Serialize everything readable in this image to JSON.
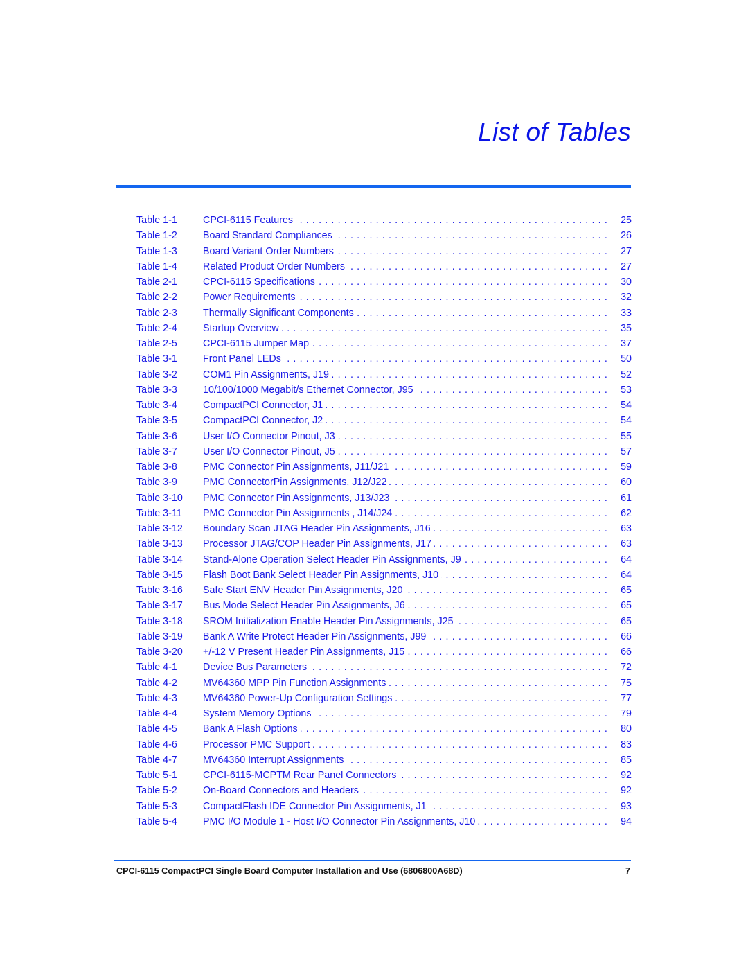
{
  "page": {
    "title": "List of Tables",
    "accent_color": "#1366f0",
    "text_color": "#1a1ae6"
  },
  "entries": [
    {
      "label": "Table 1-1",
      "title": "CPCI-6115 Features",
      "page": "25"
    },
    {
      "label": "Table 1-2",
      "title": "Board Standard Compliances",
      "page": "26"
    },
    {
      "label": "Table 1-3",
      "title": "Board Variant Order Numbers",
      "page": "27"
    },
    {
      "label": "Table 1-4",
      "title": "Related Product Order Numbers",
      "page": "27"
    },
    {
      "label": "Table 2-1",
      "title": "CPCI-6115 Specifications",
      "page": "30"
    },
    {
      "label": "Table 2-2",
      "title": "Power Requirements",
      "page": "32"
    },
    {
      "label": "Table 2-3",
      "title": "Thermally Significant Components",
      "page": "33"
    },
    {
      "label": "Table 2-4",
      "title": "Startup Overview",
      "page": "35"
    },
    {
      "label": "Table 2-5",
      "title": "CPCI-6115 Jumper Map",
      "page": "37"
    },
    {
      "label": "Table 3-1",
      "title": "Front Panel LEDs",
      "page": "50"
    },
    {
      "label": "Table 3-2",
      "title": "COM1 Pin Assignments, J19",
      "page": "52"
    },
    {
      "label": "Table 3-3",
      "title": "10/100/1000 Megabit/s Ethernet Connector, J95",
      "page": "53"
    },
    {
      "label": "Table 3-4",
      "title": "CompactPCI Connector, J1",
      "page": "54"
    },
    {
      "label": "Table 3-5",
      "title": "CompactPCI Connector, J2",
      "page": "54"
    },
    {
      "label": "Table 3-6",
      "title": "User I/O Connector Pinout, J3",
      "page": "55"
    },
    {
      "label": "Table 3-7",
      "title": "User I/O Connector Pinout, J5",
      "page": "57"
    },
    {
      "label": "Table 3-8",
      "title": "PMC Connector Pin Assignments,  J11/J21",
      "page": "59"
    },
    {
      "label": "Table 3-9",
      "title": "PMC ConnectorPin Assignments, J12/J22",
      "page": "60"
    },
    {
      "label": "Table 3-10",
      "title": "PMC Connector Pin Assignments,  J13/J23",
      "page": "61"
    },
    {
      "label": "Table 3-11",
      "title": "PMC Connector Pin Assignments ,  J14/J24",
      "page": "62"
    },
    {
      "label": "Table 3-12",
      "title": "Boundary Scan JTAG Header Pin Assignments, J16",
      "page": "63"
    },
    {
      "label": "Table 3-13",
      "title": "Processor JTAG/COP Header Pin Assignments, J17",
      "page": "63"
    },
    {
      "label": "Table 3-14",
      "title": "Stand-Alone Operation Select Header Pin Assignments, J9",
      "page": "64"
    },
    {
      "label": "Table 3-15",
      "title": "Flash Boot Bank Select Header Pin Assignments, J10",
      "page": "64"
    },
    {
      "label": "Table 3-16",
      "title": "Safe Start ENV Header Pin Assignments, J20",
      "page": "65"
    },
    {
      "label": "Table 3-17",
      "title": "Bus Mode Select Header Pin Assignments, J6",
      "page": "65"
    },
    {
      "label": "Table 3-18",
      "title": "SROM Initialization Enable Header Pin Assignments, J25",
      "page": "65"
    },
    {
      "label": "Table 3-19",
      "title": "Bank A Write Protect Header Pin Assignments, J99",
      "page": "66"
    },
    {
      "label": "Table 3-20",
      "title": "+/-12 V Present Header Pin Assignments, J15",
      "page": "66"
    },
    {
      "label": "Table 4-1",
      "title": "Device Bus Parameters",
      "page": "72"
    },
    {
      "label": "Table 4-2",
      "title": "MV64360 MPP Pin Function Assignments",
      "page": "75"
    },
    {
      "label": "Table 4-3",
      "title": "MV64360 Power-Up Configuration Settings",
      "page": "77"
    },
    {
      "label": "Table 4-4",
      "title": "System Memory Options",
      "page": "79"
    },
    {
      "label": "Table 4-5",
      "title": "Bank A Flash Options",
      "page": "80"
    },
    {
      "label": "Table 4-6",
      "title": "Processor PMC Support",
      "page": "83"
    },
    {
      "label": "Table 4-7",
      "title": "MV64360 Interrupt Assignments",
      "page": "85"
    },
    {
      "label": "Table 5-1",
      "title": "CPCI-6115-MCPTM Rear Panel Connectors",
      "page": "92"
    },
    {
      "label": "Table 5-2",
      "title": "On-Board Connectors and Headers",
      "page": "92"
    },
    {
      "label": "Table 5-3",
      "title": "CompactFlash IDE Connector Pin Assignments, J1",
      "page": "93"
    },
    {
      "label": "Table 5-4",
      "title": "PMC I/O Module 1 - Host I/O Connector Pin Assignments, J10",
      "page": "94"
    }
  ],
  "footer": {
    "text": "CPCI-6115 CompactPCI Single Board Computer Installation and Use (6806800A68D)",
    "page_number": "7"
  }
}
